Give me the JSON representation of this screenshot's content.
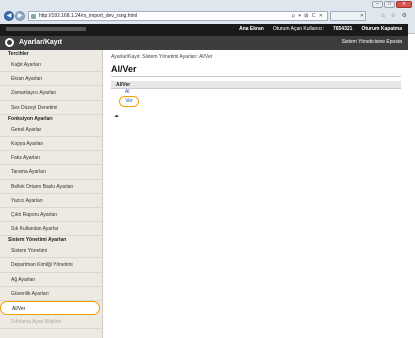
{
  "browser": {
    "url": "http://192.168.1.24/rs_import_dev_rsng.html",
    "addr_controls": "ρ ▾ ⊠ C ✕",
    "window_buttons": [
      "–",
      "□",
      "✕"
    ],
    "tab_close": "✕",
    "toolbar_icons": "⌂ ☆ ⚙"
  },
  "topbar": {
    "links": [
      "Ana Ekran",
      "Oturum Açan Kullanıcı:",
      "7654321",
      "Oturum Kapatma"
    ]
  },
  "appbar": {
    "title": "Ayarlar/Kayıt",
    "right": "Sistem Yöneticisine Eposta"
  },
  "sidebar": {
    "sections": [
      {
        "header": "Tercihler",
        "items": [
          "Kağıt Ayarları",
          "Ekran Ayarları",
          "Zamanlayıcı Ayarları",
          "Ses Düzeyi Denetimi"
        ]
      },
      {
        "header": "Fonksiyon Ayarları",
        "items": [
          "Genel Ayarlar",
          "Kopya Ayarları",
          "Faks Ayarları",
          "Tarama Ayarları",
          "Bellek Ortamı Baskı Ayarları",
          "Yazıcı Ayarları",
          "Çıktı Raporu Ayarları",
          "Sık Kullanılan Ayarlar"
        ]
      },
      {
        "header": "Sistem Yönetimi Ayarları",
        "items": [
          "Sistem Yönetimi",
          "Departman Kimliği Yönetimi",
          "Ağ Ayarları",
          "Güvenlik Ayarları",
          "Al/Ver",
          "Sıfırlama Ayarı Bilgileri"
        ]
      }
    ],
    "active_item": "Al/Ver"
  },
  "main": {
    "breadcrumb": "Ayarlar/Kayıt: Sistem Yönetimi Ayarları: Al/Ver",
    "title": "Al/Ver",
    "panel_header": "Al/Ver",
    "links": [
      "Al",
      "Ver"
    ],
    "back_to_top": "⏶"
  },
  "colors": {
    "highlight": "#f5a200",
    "link": "#1a56b8",
    "header_dark": "#1a1a1a",
    "appbar": "#3d3d3d",
    "sidebar_bg": "#eceae3"
  }
}
